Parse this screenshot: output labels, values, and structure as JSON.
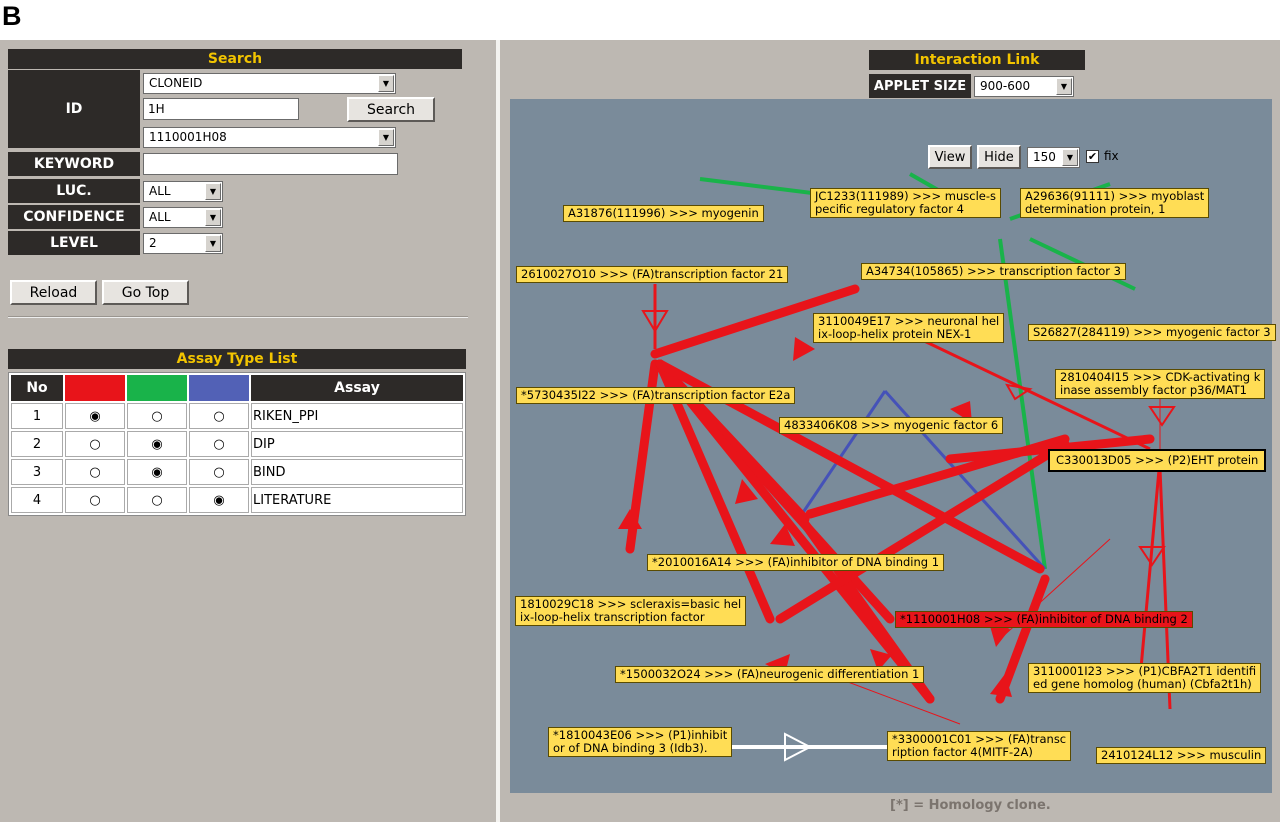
{
  "figure_letter": "B",
  "search": {
    "header": "Search",
    "id_label": "ID",
    "id_type_select": "CLONEID",
    "id_input": "1H",
    "search_button": "Search",
    "id_result_select": "1110001H08",
    "keyword_label": "KEYWORD",
    "keyword_value": "",
    "luc_label": "LUC.",
    "luc_select": "ALL",
    "confidence_label": "CONFIDENCE",
    "confidence_select": "ALL",
    "level_label": "LEVEL",
    "level_select": "2",
    "reload_button": "Reload",
    "gotop_button": "Go Top"
  },
  "assay": {
    "header": "Assay Type List",
    "col_no": "No",
    "col_assay": "Assay",
    "colors": [
      "#e8141a",
      "#19b34a",
      "#5261b6"
    ],
    "selected_glyph": "◉",
    "unselected_glyph": "○",
    "rows": [
      {
        "no": "1",
        "name": "RIKEN_PPI",
        "selected": 0
      },
      {
        "no": "2",
        "name": "DIP",
        "selected": 1
      },
      {
        "no": "3",
        "name": "BIND",
        "selected": 1
      },
      {
        "no": "4",
        "name": "LITERATURE",
        "selected": 2
      }
    ]
  },
  "interaction": {
    "header": "Interaction Link",
    "applet_size_label": "APPLET SIZE",
    "applet_size_value": "900-600",
    "view_button": "View",
    "hide_button": "Hide",
    "depth_value": "150",
    "fix_label": "fix",
    "fix_checked": true,
    "footnote": "[*] = Homology clone."
  },
  "nodes": {
    "a31876": "A31876(111996) >>> myogenin",
    "jc1233_1": "JC1233(111989) >>> muscle-s",
    "jc1233_2": "pecific regulatory factor 4",
    "a29636_1": "A29636(91111) >>> myoblast",
    "a29636_2": "determination protein, 1",
    "n2610027": "2610027O10 >>> (FA)transcription factor 21",
    "a34734": "A34734(105865) >>> transcription factor 3",
    "n3110049_1": "3110049E17 >>> neuronal hel",
    "n3110049_2": "ix-loop-helix protein NEX-1",
    "s26827": "S26827(284119) >>> myogenic factor 3",
    "n2810404_1": "2810404I15 >>> CDK-activating k",
    "n2810404_2": "inase assembly factor p36/MAT1",
    "n5730435": "*5730435I22 >>> (FA)transcription factor E2a",
    "n4833406": "4833406K08 >>> myogenic factor 6",
    "c330013": "C330013D05 >>> (P2)EHT protein",
    "n2010016": "*2010016A14 >>> (FA)inhibitor of DNA binding 1",
    "n1810029_1": "1810029C18 >>> scleraxis=basic hel",
    "n1810029_2": "ix-loop-helix transcription factor",
    "n1110001": "*1110001H08 >>> (FA)inhibitor of DNA binding 2",
    "n1500032": "*1500032O24 >>> (FA)neurogenic differentiation 1",
    "n3110001_1": "3110001I23 >>> (P1)CBFA2T1 identifi",
    "n3110001_2": "ed gene homolog (human) (Cbfa2t1h)",
    "n1810043_1": "*1810043E06 >>> (P1)inhibit",
    "n1810043_2": "or of DNA binding 3 (Idb3).",
    "n3300001_1": "*3300001C01 >>> (FA)transc",
    "n3300001_2": "ription factor 4(MITF-2A)",
    "n2410124": "2410124L12 >>> musculin"
  }
}
